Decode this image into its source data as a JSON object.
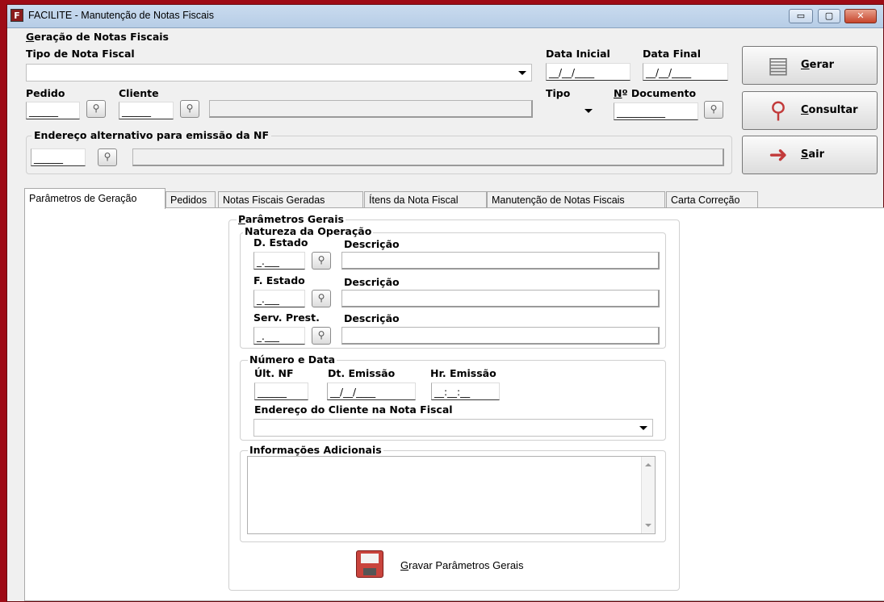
{
  "window": {
    "title": "FACILITE - Manutenção de Notas Fiscais",
    "icon": "F",
    "minimize": "▭",
    "maximize": "▢",
    "close": "✕"
  },
  "header": {
    "group_title": "Geração de Notas Fiscais",
    "tipo_nota_label": "Tipo de Nota Fiscal",
    "data_inicial_label": "Data Inicial",
    "data_final_label": "Data Final",
    "data_inicial_value": "__/__/____",
    "data_final_value": "__/__/____",
    "pedido_label": "Pedido",
    "pedido_value": "______",
    "cliente_label": "Cliente",
    "cliente_value": "______",
    "tipo_label": "Tipo",
    "ndoc_label": "Nº Documento",
    "ndoc_value": "__________",
    "endereco_label": "Endereço alternativo para emissão da NF",
    "endereco_value": "______"
  },
  "buttons": {
    "gerar": "Gerar",
    "consultar": "Consultar",
    "sair": "Sair",
    "search_glyph": "⚲"
  },
  "tabs": [
    {
      "label": "Parâmetros de Geração"
    },
    {
      "label": "Pedidos"
    },
    {
      "label": "Notas Fiscais Geradas"
    },
    {
      "label": "Ítens da Nota Fiscal"
    },
    {
      "label": "Manutenção de Notas Fiscais"
    },
    {
      "label": "Carta Correção"
    }
  ],
  "params": {
    "group_title": "Parâmetros Gerais",
    "natureza_title": "Natureza da Operação",
    "d_estado_label": "D. Estado",
    "f_estado_label": "F. Estado",
    "serv_label": "Serv. Prest.",
    "descricao_label": "Descrição",
    "cfop_value": "_.___",
    "numero_title": "Número e Data",
    "ult_nf_label": "Últ. NF",
    "dt_emissao_label": "Dt. Emissão",
    "hr_emissao_label": "Hr. Emissão",
    "ult_nf_value": "______",
    "dt_emissao_value": "__/__/____",
    "hr_emissao_value": "__:__:__",
    "endereco_cliente_label": "Endereço do Cliente na Nota Fiscal",
    "info_title": "Informações Adicionais",
    "gravar_label": "Gravar Parâmetros Gerais"
  },
  "colors": {
    "desktop": "#9e0b16",
    "window": "#f0f0f0",
    "titlebar": "#c9dbef"
  }
}
